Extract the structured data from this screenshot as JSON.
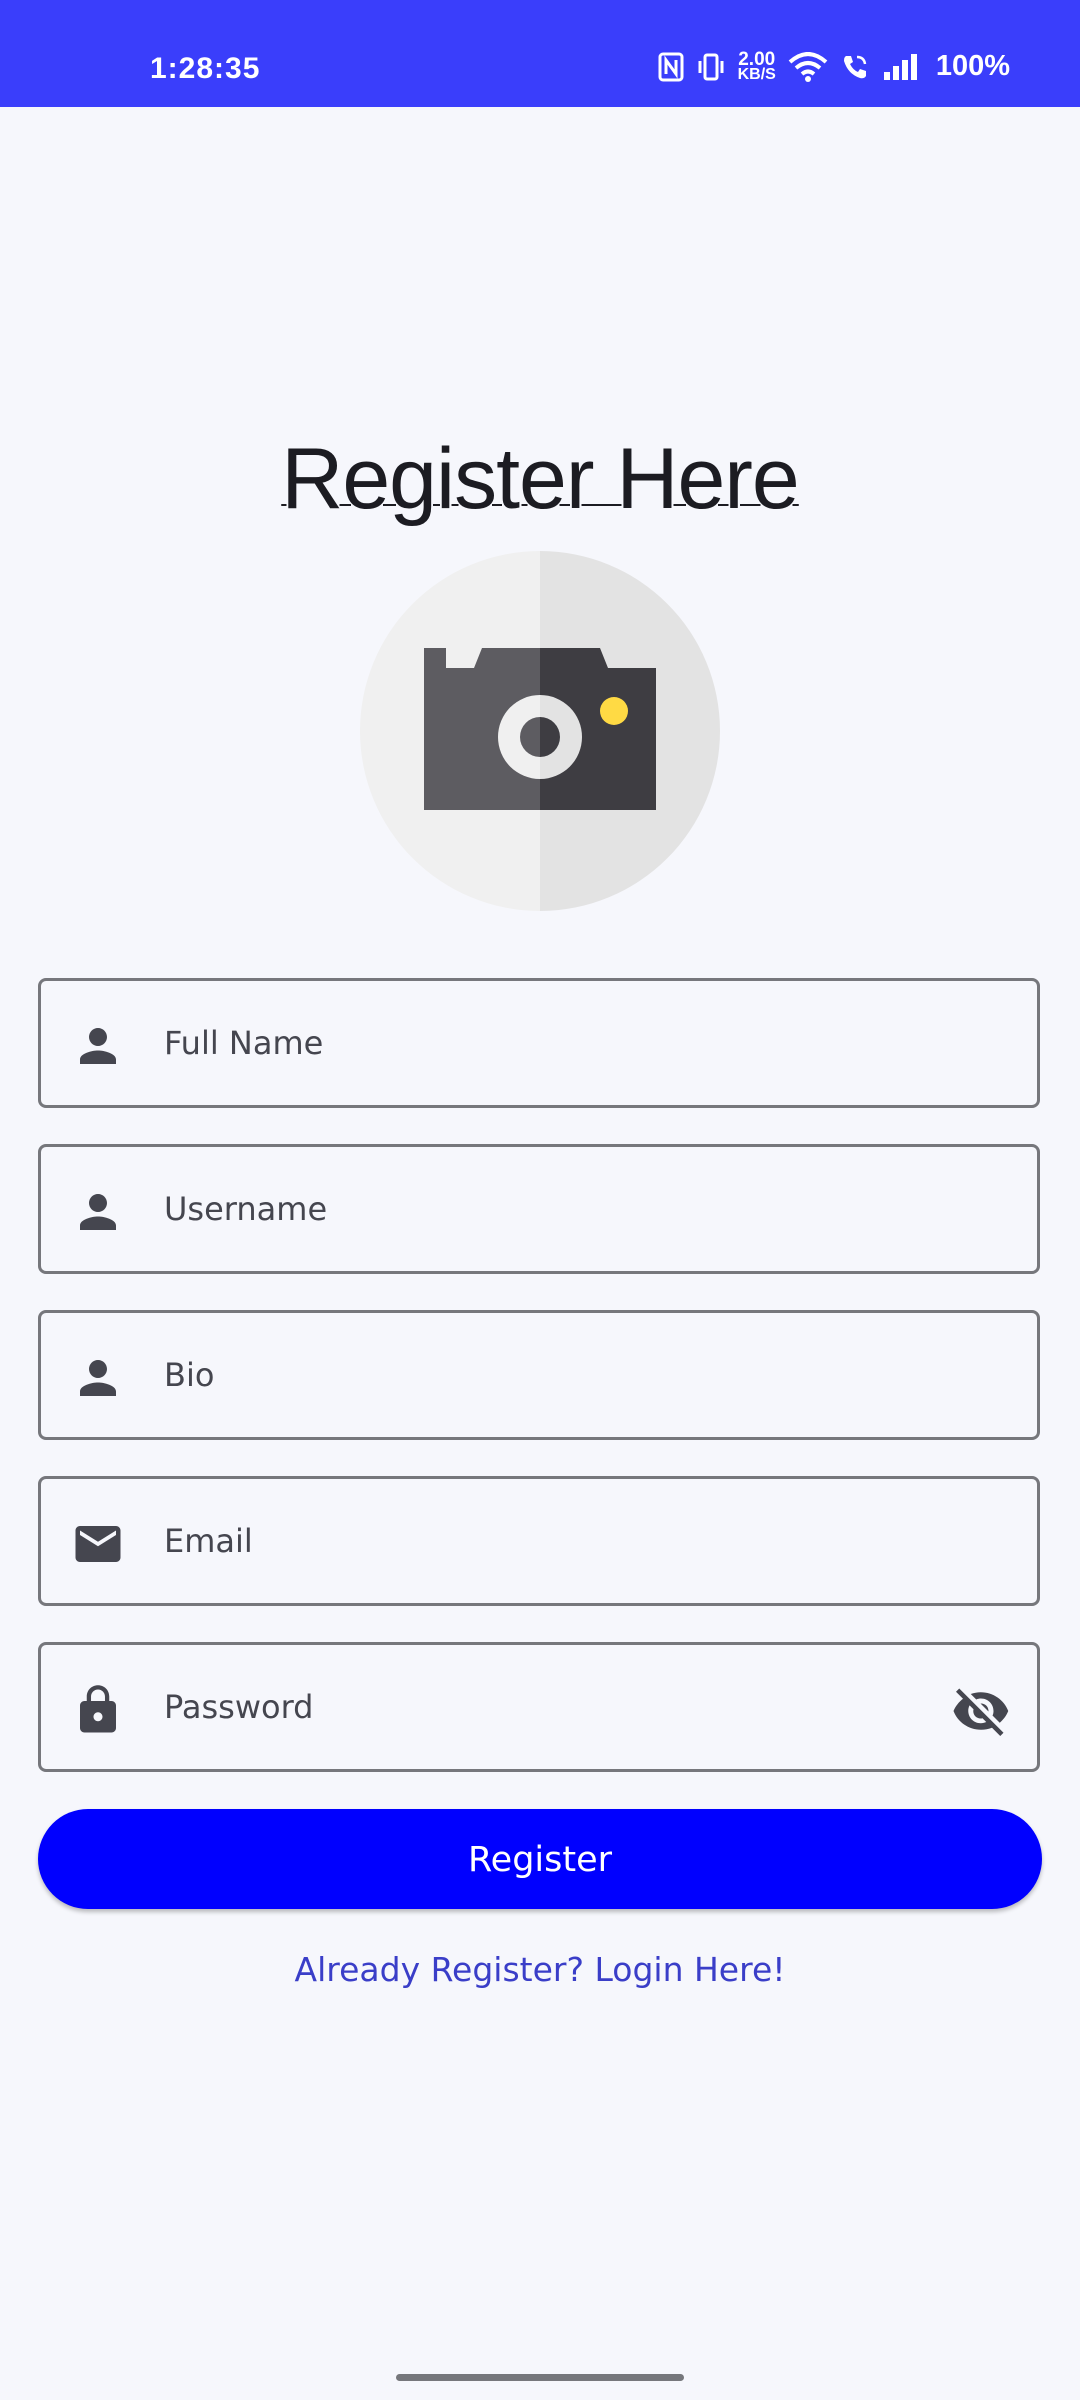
{
  "status_bar": {
    "time": "1:28:35",
    "net_speed_value": "2.00",
    "net_speed_unit": "KB/S",
    "battery": "100%",
    "color": "#3A3EFB"
  },
  "page": {
    "title": "Register Here"
  },
  "form": {
    "full_name": {
      "placeholder": "Full Name",
      "icon": "person-icon"
    },
    "username": {
      "placeholder": "Username",
      "icon": "person-icon"
    },
    "bio": {
      "placeholder": "Bio",
      "icon": "person-icon"
    },
    "email": {
      "placeholder": "Email",
      "icon": "mail-icon"
    },
    "password": {
      "placeholder": "Password",
      "icon": "lock-icon",
      "toggle_icon": "eye-off-icon"
    }
  },
  "actions": {
    "register_label": "Register",
    "login_link": "Already Register? Login Here!",
    "button_color": "#0000FF",
    "link_color": "#3A3EC8"
  }
}
